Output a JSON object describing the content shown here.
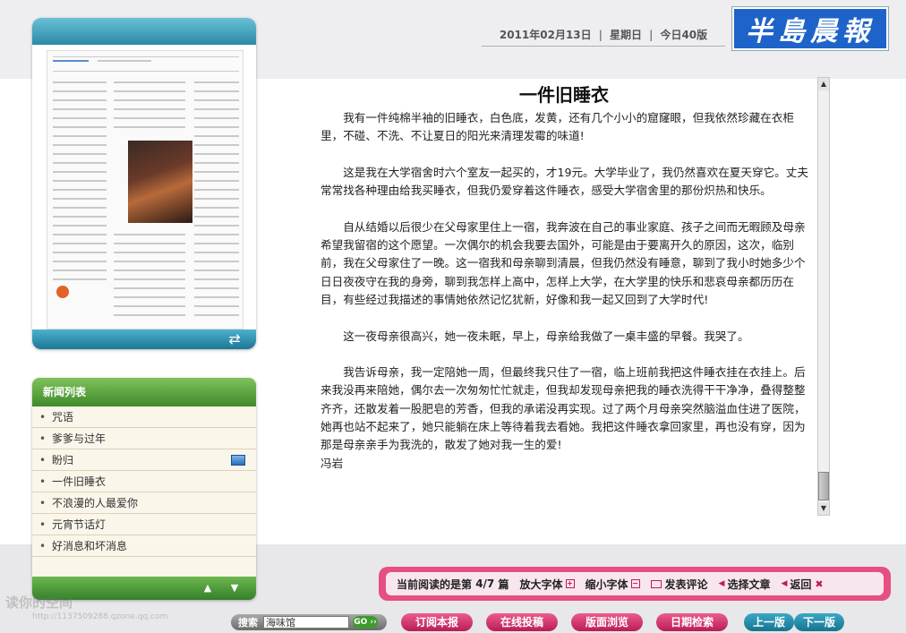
{
  "header": {
    "date": "2011年02月13日",
    "weekday": "星期日",
    "pages": "今日40版",
    "logo_text": "半島晨報"
  },
  "thumbnail": {
    "refresh_icon": "refresh-icon"
  },
  "news_list": {
    "title": "新闻列表",
    "items": [
      {
        "label": "咒语"
      },
      {
        "label": "爹爹与过年"
      },
      {
        "label": "盼归",
        "icon": "image-icon"
      },
      {
        "label": "一件旧睡衣"
      },
      {
        "label": "不浪漫的人最爱你"
      },
      {
        "label": "元宵节话灯"
      },
      {
        "label": "好消息和坏消息"
      }
    ]
  },
  "article": {
    "title": "一件旧睡衣",
    "paragraphs": [
      "我有一件纯棉半袖的旧睡衣，白色底，发黄，还有几个小小的窟窿眼，但我依然珍藏在衣柜里，不碰、不洗、不让夏日的阳光来清理发霉的味道!",
      "这是我在大学宿舍时六个室友一起买的，才19元。大学毕业了，我仍然喜欢在夏天穿它。丈夫常常找各种理由给我买睡衣，但我仍爱穿着这件睡衣，感受大学宿舍里的那份炽热和快乐。",
      "自从结婚以后很少在父母家里住上一宿，我奔波在自己的事业家庭、孩子之间而无暇顾及母亲希望我留宿的这个愿望。一次偶尔的机会我要去国外，可能是由于要离开久的原因，这次，临别前，我在父母家住了一晚。这一宿我和母亲聊到清晨，但我仍然没有睡意，聊到了我小时她多少个日日夜夜守在我的身旁，聊到我怎样上高中，怎样上大学，在大学里的快乐和悲哀母亲都历历在目，有些经过我描述的事情她依然记忆犹新，好像和我一起又回到了大学时代!",
      "这一夜母亲很高兴，她一夜未眠，早上，母亲给我做了一桌丰盛的早餐。我哭了。",
      "我告诉母亲，我一定陪她一周，但最终我只住了一宿，临上班前我把这件睡衣挂在衣挂上。后来我没再来陪她，偶尔去一次匆匆忙忙就走，但我却发现母亲把我的睡衣洗得干干净净，叠得整整齐齐，还散发着一股肥皂的芳香，但我的承诺没再实现。过了两个月母亲突然脑溢血住进了医院，她再也站不起来了，她只能躺在床上等待着我去看她。我把这件睡衣拿回家里，再也没有穿，因为那是母亲亲手为我洗的，散发了她对我一生的爱!"
    ],
    "author": "冯岩"
  },
  "reading_bar": {
    "current_label": "当前阅读的是第",
    "current_value": "4/7",
    "current_unit": "篇",
    "enlarge": "放大字体",
    "shrink": "缩小字体",
    "comment": "发表评论",
    "select": "选择文章",
    "back": "返回"
  },
  "bottom_nav": {
    "search_label": "搜索",
    "search_value": "海味馆",
    "go_label": "GO ››",
    "subscribe": "订阅本报",
    "submit": "在线投稿",
    "browse": "版面浏览",
    "date_search": "日期检索",
    "prev_page": "上一版",
    "next_page": "下一版"
  },
  "watermark": {
    "text": "读你的空间",
    "url": "http://1137509288.qzone.qq.com"
  },
  "colors": {
    "accent_teal": "#2b8aa8",
    "accent_green": "#3f8a2a",
    "accent_pink": "#e64f82",
    "logo_blue": "#1e63c9"
  }
}
